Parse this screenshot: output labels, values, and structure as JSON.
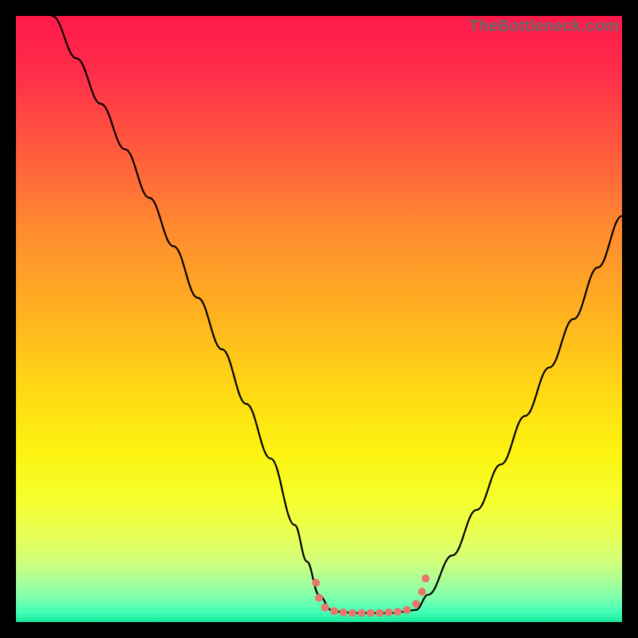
{
  "watermark": "TheBottleneck.com",
  "chart_data": {
    "type": "line",
    "title": "",
    "xlabel": "",
    "ylabel": "",
    "xlim": [
      0,
      100
    ],
    "ylim": [
      0,
      100
    ],
    "grid": false,
    "legend": false,
    "background_gradient": {
      "stops": [
        {
          "pos": 0.0,
          "color": "#ff1a4b"
        },
        {
          "pos": 0.1,
          "color": "#ff2f49"
        },
        {
          "pos": 0.22,
          "color": "#ff5a3e"
        },
        {
          "pos": 0.35,
          "color": "#ff8a2f"
        },
        {
          "pos": 0.5,
          "color": "#ffb41f"
        },
        {
          "pos": 0.62,
          "color": "#ffd914"
        },
        {
          "pos": 0.72,
          "color": "#fcf311"
        },
        {
          "pos": 0.8,
          "color": "#f6ff2e"
        },
        {
          "pos": 0.86,
          "color": "#e7ff58"
        },
        {
          "pos": 0.9,
          "color": "#d0ff7a"
        },
        {
          "pos": 0.93,
          "color": "#acff97"
        },
        {
          "pos": 0.96,
          "color": "#7effae"
        },
        {
          "pos": 0.985,
          "color": "#3fffb4"
        },
        {
          "pos": 1.0,
          "color": "#17e89a"
        }
      ]
    },
    "series": [
      {
        "name": "left-curve",
        "color": "#000000",
        "x": [
          6,
          10,
          14,
          18,
          22,
          26,
          30,
          34,
          38,
          42,
          46,
          48,
          50,
          52
        ],
        "y": [
          100,
          93,
          85.5,
          78,
          70,
          62,
          53.5,
          45,
          36,
          27,
          16,
          10,
          4.5,
          2
        ]
      },
      {
        "name": "right-curve",
        "color": "#000000",
        "x": [
          66,
          68,
          72,
          76,
          80,
          84,
          88,
          92,
          96,
          100
        ],
        "y": [
          2,
          4.5,
          11,
          18.5,
          26,
          34,
          42,
          50,
          58.5,
          67
        ]
      },
      {
        "name": "flat-bottom",
        "color": "#000000",
        "x": [
          52,
          54,
          56,
          58,
          60,
          62,
          64,
          66
        ],
        "y": [
          2,
          1.6,
          1.5,
          1.5,
          1.5,
          1.5,
          1.7,
          2
        ]
      }
    ],
    "markers": [
      {
        "name": "cluster-left",
        "color": "#e9776e",
        "points": [
          {
            "x": 49.5,
            "y": 6.5,
            "r": 5
          },
          {
            "x": 50.0,
            "y": 4.0,
            "r": 5
          },
          {
            "x": 51.0,
            "y": 2.4,
            "r": 5
          },
          {
            "x": 52.5,
            "y": 1.8,
            "r": 5
          },
          {
            "x": 54.0,
            "y": 1.6,
            "r": 5
          }
        ]
      },
      {
        "name": "cluster-bottom",
        "color": "#e9776e",
        "points": [
          {
            "x": 55.5,
            "y": 1.5,
            "r": 5
          },
          {
            "x": 57.0,
            "y": 1.5,
            "r": 5
          },
          {
            "x": 58.5,
            "y": 1.5,
            "r": 5
          },
          {
            "x": 60.0,
            "y": 1.5,
            "r": 5
          },
          {
            "x": 61.5,
            "y": 1.6,
            "r": 5
          },
          {
            "x": 63.0,
            "y": 1.7,
            "r": 5
          }
        ]
      },
      {
        "name": "cluster-right",
        "color": "#e9776e",
        "points": [
          {
            "x": 64.5,
            "y": 2.0,
            "r": 5
          },
          {
            "x": 66.0,
            "y": 3.0,
            "r": 5
          },
          {
            "x": 67.0,
            "y": 5.0,
            "r": 5
          },
          {
            "x": 67.6,
            "y": 7.2,
            "r": 5
          }
        ]
      }
    ]
  }
}
